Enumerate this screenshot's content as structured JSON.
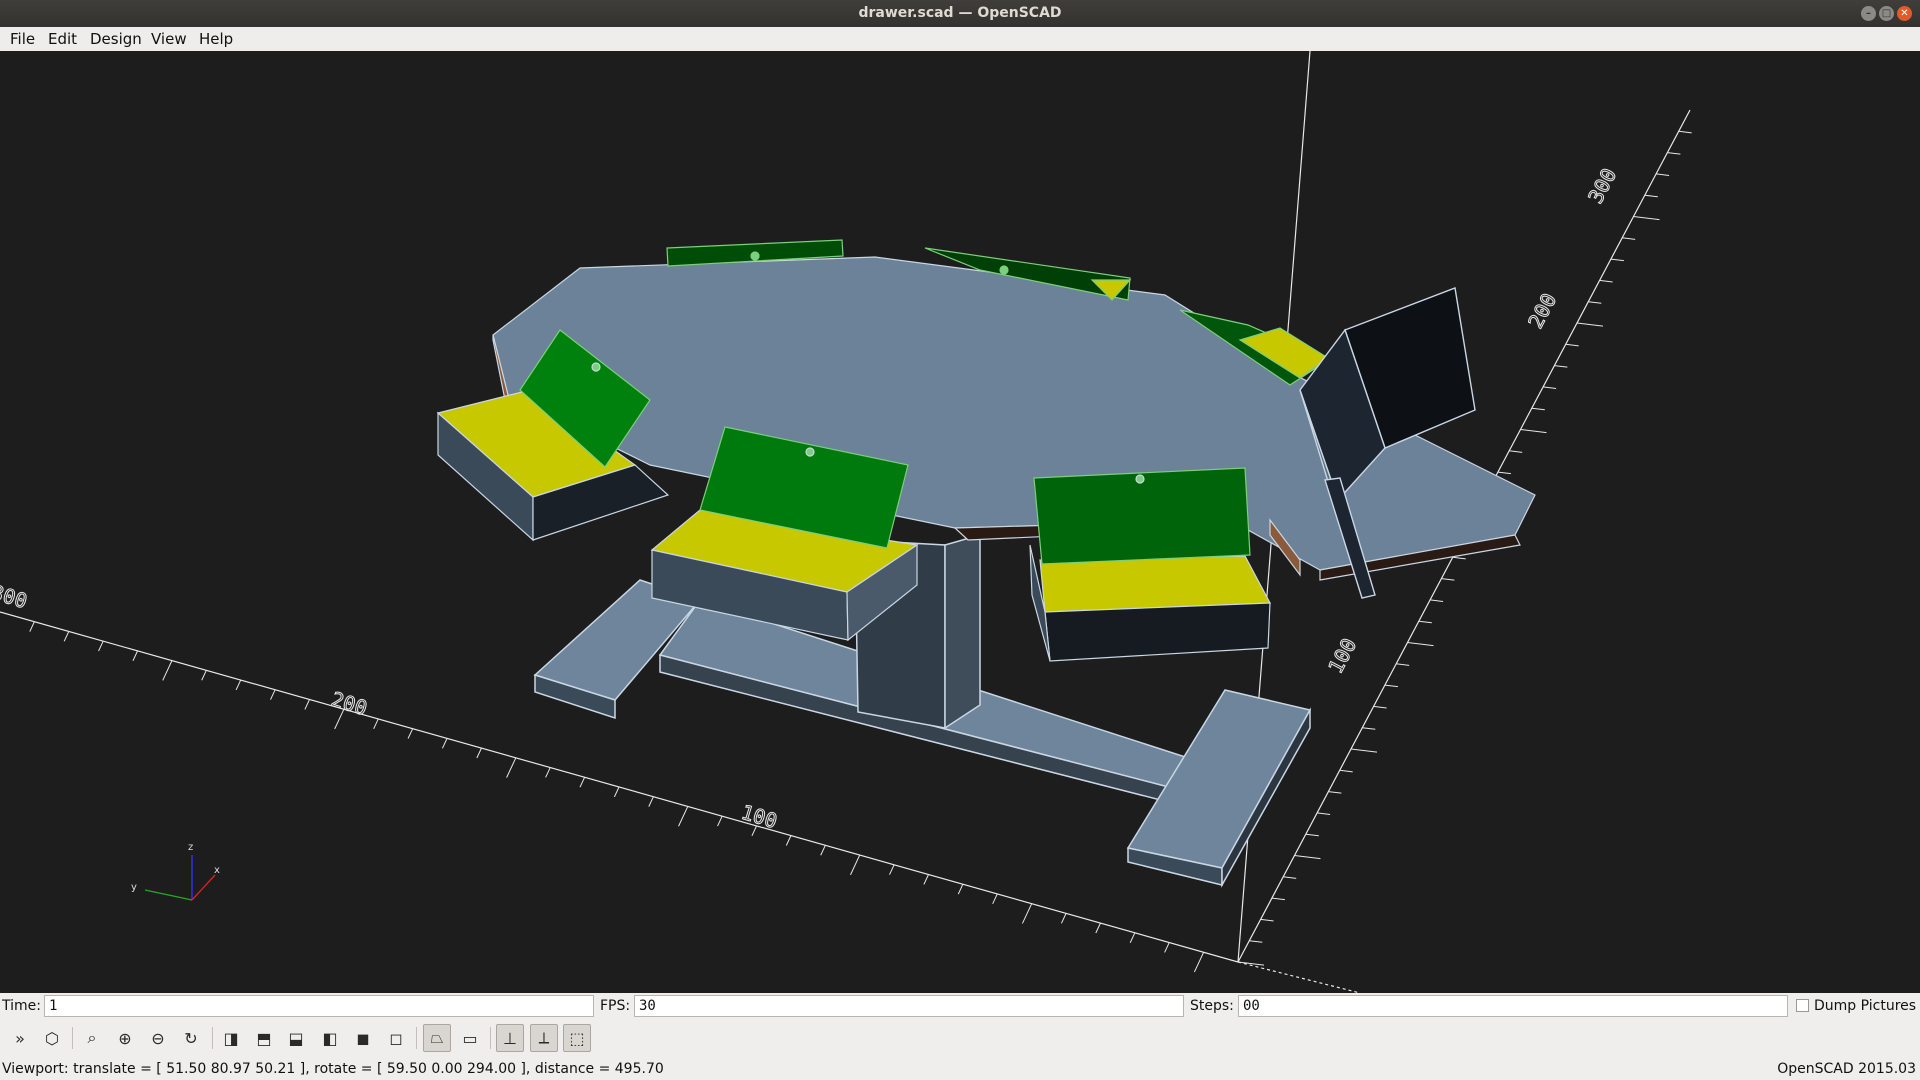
{
  "window": {
    "title": "drawer.scad — OpenSCAD"
  },
  "menu": {
    "items": [
      "File",
      "Edit",
      "Design",
      "View",
      "Help"
    ]
  },
  "viewport": {
    "background": "#1d1d1e",
    "axis_scale_labels": [
      "100",
      "200",
      "300",
      "100",
      "200",
      "300",
      "100"
    ],
    "axis_gizmo": {
      "x": "x",
      "y": "y",
      "z": "z"
    },
    "colors": {
      "table_top": "#6b8299",
      "drawer_green": "#00730a",
      "drawer_yellow": "#c8c800",
      "box_side": "#36424e"
    }
  },
  "animate": {
    "time_label": "Time:",
    "time_value": "1",
    "fps_label": "FPS:",
    "fps_value": "30",
    "steps_label": "Steps:",
    "steps_value": "00",
    "dump_pictures_label": "Dump Pictures"
  },
  "toolbar": {
    "icons": [
      "preview-icon",
      "render-icon",
      "view-all-icon",
      "zoom-in-icon",
      "zoom-out-icon",
      "reset-view-icon",
      "view-right-icon",
      "view-top-icon",
      "view-bottom-icon",
      "view-left-icon",
      "view-front-icon",
      "view-back-icon",
      "perspective-icon",
      "orthogonal-icon",
      "show-axes-icon",
      "show-scale-markers-icon",
      "show-edges-icon"
    ]
  },
  "status": {
    "viewport_text": "Viewport: translate = [ 51.50 80.97 50.21 ], rotate = [ 59.50 0.00 294.00 ], distance = 495.70",
    "version": "OpenSCAD 2015.03"
  }
}
